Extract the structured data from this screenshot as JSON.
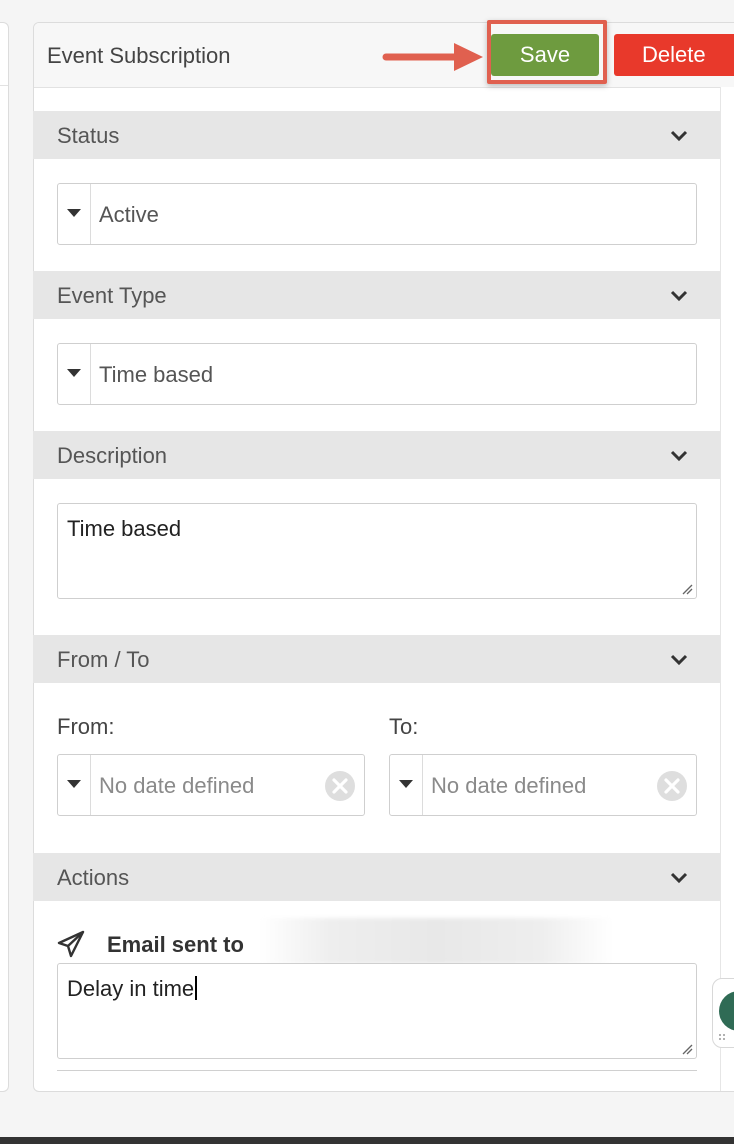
{
  "panel": {
    "title": "Event Subscription",
    "save_label": "Save",
    "delete_label": "Delete"
  },
  "sections": {
    "status": {
      "label": "Status",
      "value": "Active"
    },
    "event_type": {
      "label": "Event Type",
      "value": "Time based"
    },
    "description": {
      "label": "Description",
      "value": "Time based"
    },
    "from_to": {
      "label": "From / To",
      "from_label": "From:",
      "from_placeholder": "No date defined",
      "to_label": "To:",
      "to_placeholder": "No date defined"
    },
    "actions": {
      "label": "Actions",
      "email_label": "Email sent to",
      "message_value": "Delay in time"
    }
  },
  "icons": {
    "chevron": "chevron-down-icon",
    "caret": "caret-down-icon",
    "clear": "clear-circle-icon",
    "send": "paper-plane-icon",
    "annotation": "arrow-right-icon"
  },
  "colors": {
    "save_bg": "#6e9b3f",
    "delete_bg": "#e8392b",
    "highlight": "#e0604f",
    "section_bg": "#e6e6e6",
    "chat_widget": "#2f6b55"
  }
}
